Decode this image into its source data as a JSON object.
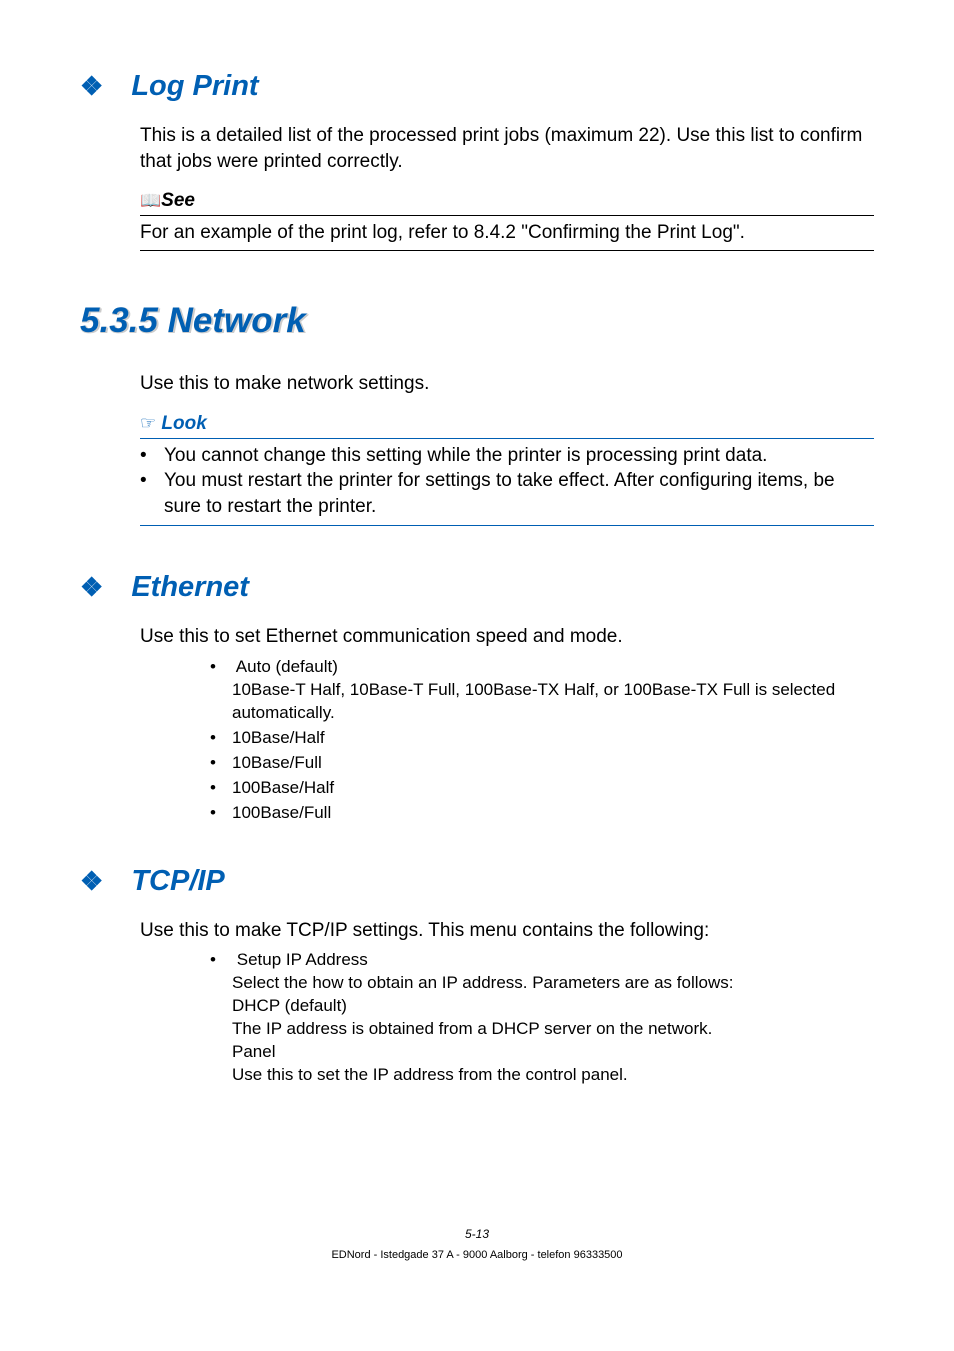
{
  "logprint": {
    "title": "Log Print",
    "body": "This is a detailed list of the processed print jobs (maximum 22). Use this list to confirm that jobs were printed correctly.",
    "see_label": "See",
    "see_text": "For an example of the print log, refer to 8.4.2 \"Confirming the Print Log\"."
  },
  "network": {
    "title": "5.3.5  Network",
    "body": "Use this to make network settings.",
    "look_label": " Look",
    "look_items": [
      "You cannot change this setting while the printer is processing print data.",
      "You must restart the printer for settings to take effect. After configuring items, be sure to restart the printer."
    ]
  },
  "ethernet": {
    "title": "Ethernet",
    "body": "Use this to set Ethernet communication speed and mode.",
    "items": [
      {
        "label": "Auto (default)",
        "sub": "10Base-T Half, 10Base-T Full, 100Base-TX Half, or 100Base-TX Full is selected automatically."
      },
      {
        "label": "10Base/Half",
        "sub": ""
      },
      {
        "label": "10Base/Full",
        "sub": ""
      },
      {
        "label": "100Base/Half",
        "sub": ""
      },
      {
        "label": "100Base/Full",
        "sub": ""
      }
    ]
  },
  "tcpip": {
    "title": "TCP/IP",
    "body": "Use this to make TCP/IP settings. This menu contains the following:",
    "items": [
      {
        "label": "Setup IP Address",
        "sub": "Select the how to obtain an IP address. Parameters are as follows:\nDHCP (default)\nThe IP address is obtained from a DHCP server on the network.\nPanel\nUse this to set the IP address from the control panel."
      }
    ]
  },
  "footer": {
    "page": "5-13",
    "line": "EDNord - Istedgade 37 A - 9000 Aalborg - telefon 96333500"
  }
}
